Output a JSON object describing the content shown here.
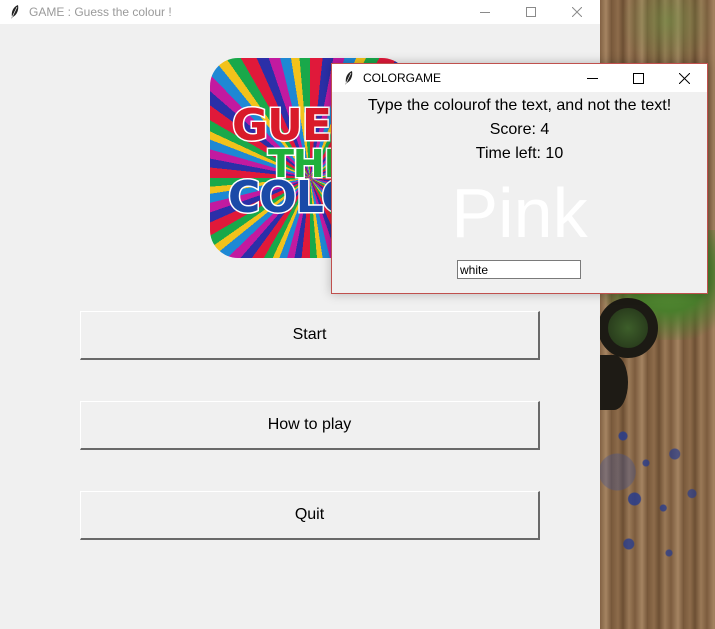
{
  "main_window": {
    "title": "GAME : Guess the colour !",
    "logo_text": [
      "GUESS",
      "THE",
      "COLOUR"
    ],
    "buttons": {
      "start": "Start",
      "how_to_play": "How to play",
      "quit": "Quit"
    }
  },
  "game_window": {
    "title": "COLORGAME",
    "instruction": "Type the colourof the text, and not the text!",
    "score": "Score: 4",
    "time_left": "Time left: 10",
    "color_word": "Pink",
    "color_word_color": "#ffffff",
    "entry_value": "white"
  },
  "colors": {
    "window_bg": "#f0f0f0",
    "popup_border": "#c0504d"
  },
  "icons": {
    "app_icon": "feather-icon",
    "minimize": "minimize-icon",
    "maximize": "maximize-icon",
    "close": "close-icon"
  }
}
